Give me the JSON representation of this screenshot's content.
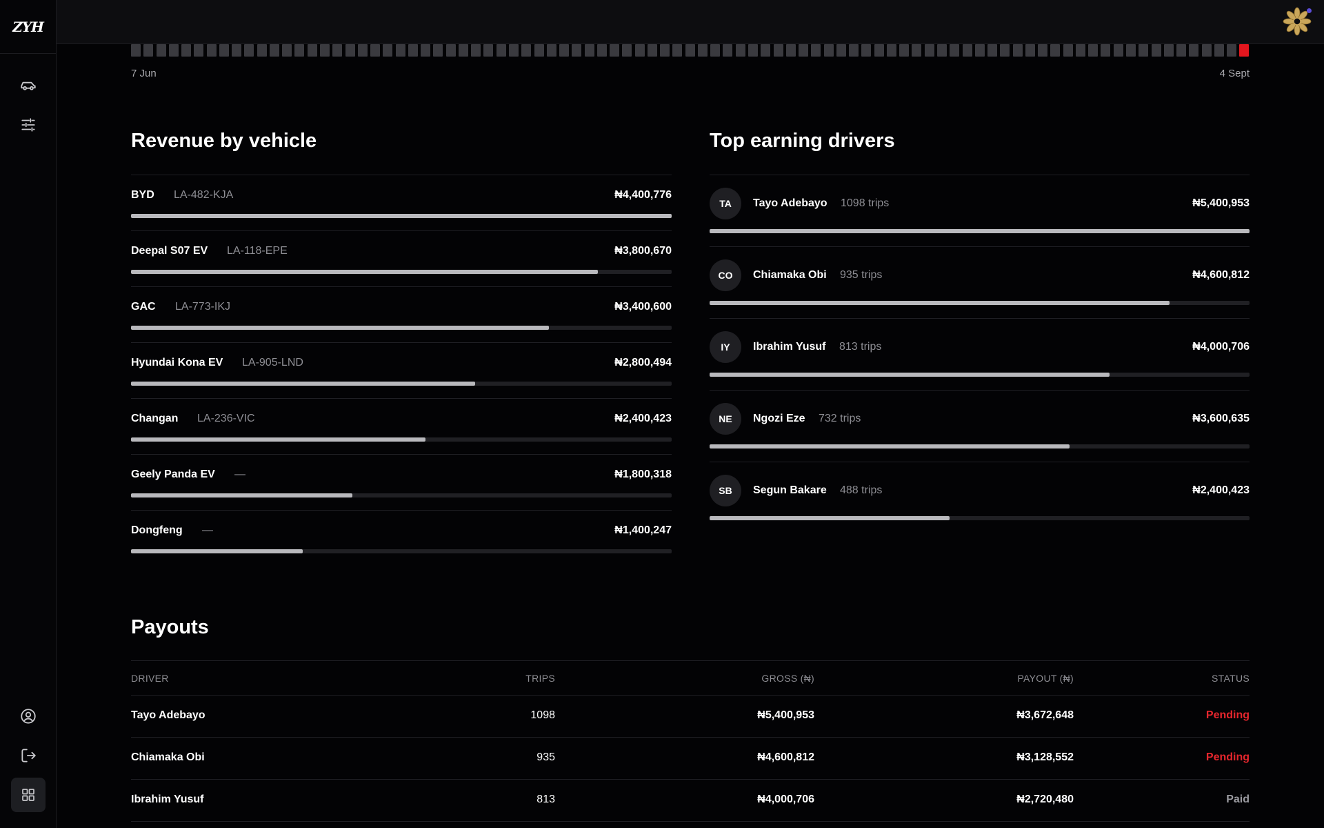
{
  "app": {
    "logo_text": "ZYH"
  },
  "sidebar": {
    "top_items": [
      {
        "icon": "car-icon"
      },
      {
        "icon": "sliders-icon"
      }
    ],
    "bottom_items": [
      {
        "icon": "user-circle-icon"
      },
      {
        "icon": "logout-icon"
      },
      {
        "icon": "grid-icon",
        "active": true
      }
    ]
  },
  "activity": {
    "start_label": "7 Jun",
    "end_label": "4 Sept",
    "cell_count": 89,
    "highlight_last": true,
    "colors": {
      "cell": "#3a3a3f",
      "highlight": "#e3161e"
    }
  },
  "revenue_by_vehicle": {
    "title": "Revenue by vehicle",
    "items": [
      {
        "name": "BYD",
        "plate": "LA-482-KJA",
        "amount": "₦4,400,776",
        "share": 1.0
      },
      {
        "name": "Deepal S07 EV",
        "plate": "LA-118-EPE",
        "amount": "₦3,800,670",
        "share": 0.864
      },
      {
        "name": "GAC",
        "plate": "LA-773-IKJ",
        "amount": "₦3,400,600",
        "share": 0.773
      },
      {
        "name": "Hyundai Kona EV",
        "plate": "LA-905-LND",
        "amount": "₦2,800,494",
        "share": 0.636
      },
      {
        "name": "Changan",
        "plate": "LA-236-VIC",
        "amount": "₦2,400,423",
        "share": 0.545
      },
      {
        "name": "Geely Panda EV",
        "plate": "—",
        "amount": "₦1,800,318",
        "share": 0.409
      },
      {
        "name": "Dongfeng",
        "plate": "—",
        "amount": "₦1,400,247",
        "share": 0.318
      }
    ]
  },
  "top_drivers": {
    "title": "Top earning drivers",
    "items": [
      {
        "initials": "TA",
        "name": "Tayo Adebayo",
        "trips": "1098 trips",
        "amount": "₦5,400,953",
        "share": 1.0
      },
      {
        "initials": "CO",
        "name": "Chiamaka Obi",
        "trips": "935 trips",
        "amount": "₦4,600,812",
        "share": 0.852
      },
      {
        "initials": "IY",
        "name": "Ibrahim Yusuf",
        "trips": "813 trips",
        "amount": "₦4,000,706",
        "share": 0.741
      },
      {
        "initials": "NE",
        "name": "Ngozi Eze",
        "trips": "732 trips",
        "amount": "₦3,600,635",
        "share": 0.667
      },
      {
        "initials": "SB",
        "name": "Segun Bakare",
        "trips": "488 trips",
        "amount": "₦2,400,423",
        "share": 0.444
      }
    ]
  },
  "payouts": {
    "title": "Payouts",
    "columns": {
      "driver": "DRIVER",
      "trips": "TRIPS",
      "gross": "GROSS (₦)",
      "payout": "PAYOUT (₦)",
      "status": "STATUS"
    },
    "rows": [
      {
        "driver": "Tayo Adebayo",
        "trips": "1098",
        "gross": "₦5,400,953",
        "payout": "₦3,672,648",
        "status": "Pending"
      },
      {
        "driver": "Chiamaka Obi",
        "trips": "935",
        "gross": "₦4,600,812",
        "payout": "₦3,128,552",
        "status": "Pending"
      },
      {
        "driver": "Ibrahim Yusuf",
        "trips": "813",
        "gross": "₦4,000,706",
        "payout": "₦2,720,480",
        "status": "Paid"
      }
    ]
  }
}
